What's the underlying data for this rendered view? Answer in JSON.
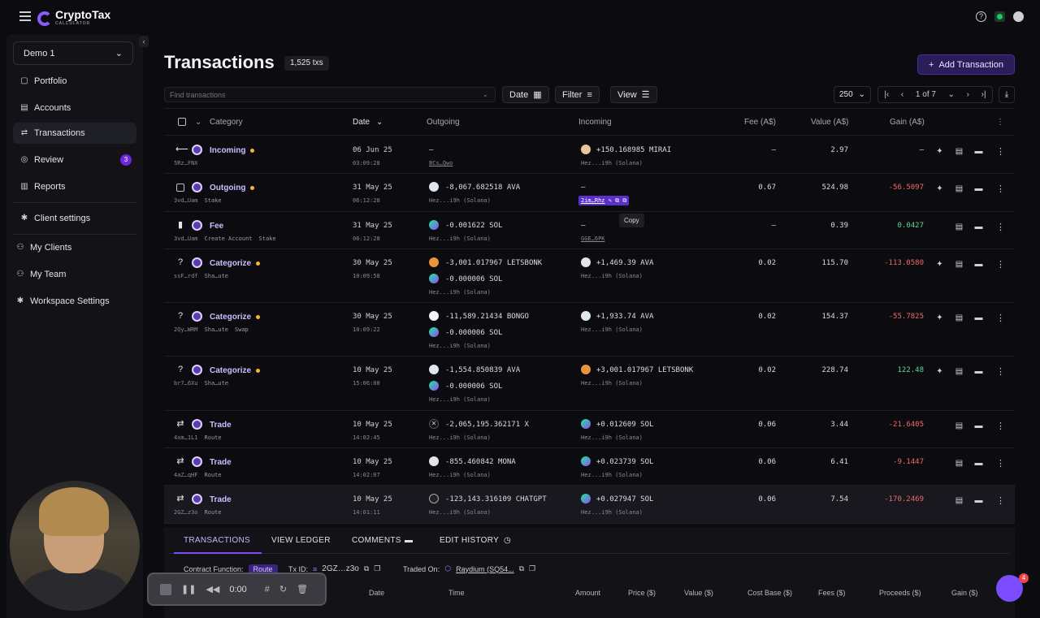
{
  "app": {
    "logo_main": "CryptoTax",
    "logo_sub": "CALCULATOR"
  },
  "sidebar": {
    "org": "Demo 1",
    "items": [
      {
        "label": "Portfolio"
      },
      {
        "label": "Accounts"
      },
      {
        "label": "Transactions"
      },
      {
        "label": "Review",
        "badge": "3"
      },
      {
        "label": "Reports"
      },
      {
        "label": "Client settings"
      },
      {
        "label": "My Clients"
      },
      {
        "label": "My Team"
      },
      {
        "label": "Workspace Settings"
      }
    ]
  },
  "header": {
    "title": "Transactions",
    "count": "1,525 txs",
    "add_button": "Add Transaction"
  },
  "toolbar": {
    "search_placeholder": "Find transactions",
    "date": "Date",
    "filter": "Filter",
    "view": "View",
    "page_size": "250",
    "page_info": "1 of 7"
  },
  "table": {
    "columns": {
      "category": "Category",
      "date": "Date",
      "outgoing": "Outgoing",
      "incoming": "Incoming",
      "fee": "Fee (A$)",
      "value": "Value (A$)",
      "gain": "Gain (A$)"
    },
    "rows": [
      {
        "category": "Incoming",
        "id": "5Rz…FNX",
        "tags": [],
        "date": "06 Jun 25",
        "time": "03:09:28",
        "out": [
          "—"
        ],
        "out_wallet": "BCs…Qwo",
        "in": [
          "+150.168985 MIRAI"
        ],
        "in_wallet": "Hez...i9h (Solana)",
        "fee": "—",
        "value": "2.97",
        "gain": "—"
      },
      {
        "category": "Outgoing",
        "id": "3vd…Uam",
        "tags": [
          "Stake"
        ],
        "date": "31 May 25",
        "time": "06:12:28",
        "out": [
          "-8,067.682518 AVA"
        ],
        "out_wallet": "Hez...i9h (Solana)",
        "in": [
          "—"
        ],
        "in_wallet": "2im…Rhz",
        "fee": "0.67",
        "value": "524.98",
        "gain": "-56.5097"
      },
      {
        "category": "Fee",
        "id": "3vd…Uam",
        "tags": [
          "Create Account",
          "Stake"
        ],
        "date": "31 May 25",
        "time": "06:12:28",
        "out": [
          "-0.001622 SOL"
        ],
        "out_wallet": "Hez...i9h (Solana)",
        "in": [
          "—"
        ],
        "in_wallet": "GGE…6PK",
        "fee": "—",
        "value": "0.39",
        "gain": "0.0427"
      },
      {
        "category": "Categorize",
        "id": "ssF…rdf",
        "tags": [
          "Sha…ute"
        ],
        "date": "30 May 25",
        "time": "10:09:58",
        "out": [
          "-3,001.017967 LETSBONK",
          "-0.000006 SOL"
        ],
        "out_wallet": "Hez...i9h (Solana)",
        "in": [
          "+1,469.39 AVA"
        ],
        "in_wallet": "Hez...i9h (Solana)",
        "fee": "0.02",
        "value": "115.70",
        "gain": "-113.0580"
      },
      {
        "category": "Categorize",
        "id": "2Qy…WRM",
        "tags": [
          "Sha…ute",
          "Swap"
        ],
        "date": "30 May 25",
        "time": "10:09:22",
        "out": [
          "-11,589.21434 BONGO",
          "-0.000006 SOL"
        ],
        "out_wallet": "Hez...i9h (Solana)",
        "in": [
          "+1,933.74 AVA"
        ],
        "in_wallet": "Hez...i9h (Solana)",
        "fee": "0.02",
        "value": "154.37",
        "gain": "-55.7825"
      },
      {
        "category": "Categorize",
        "id": "br7…6Xu",
        "tags": [
          "Sha…ute"
        ],
        "date": "10 May 25",
        "time": "15:06:00",
        "out": [
          "-1,554.850839 AVA",
          "-0.000006 SOL"
        ],
        "out_wallet": "Hez...i9h (Solana)",
        "in": [
          "+3,001.017967 LETSBONK"
        ],
        "in_wallet": "Hez...i9h (Solana)",
        "fee": "0.02",
        "value": "228.74",
        "gain": "122.48"
      },
      {
        "category": "Trade",
        "id": "4xm…1L1",
        "tags": [
          "Route"
        ],
        "date": "10 May 25",
        "time": "14:02:45",
        "out": [
          "-2,065,195.362171 X"
        ],
        "out_wallet": "Hez...i9h (Solana)",
        "in": [
          "+0.012609 SOL"
        ],
        "in_wallet": "Hez...i9h (Solana)",
        "fee": "0.06",
        "value": "3.44",
        "gain": "-21.6405"
      },
      {
        "category": "Trade",
        "id": "4aZ…qHF",
        "tags": [
          "Route"
        ],
        "date": "10 May 25",
        "time": "14:02:07",
        "out": [
          "-855.460842 MONA"
        ],
        "out_wallet": "Hez...i9h (Solana)",
        "in": [
          "+0.023739 SOL"
        ],
        "in_wallet": "Hez...i9h (Solana)",
        "fee": "0.06",
        "value": "6.41",
        "gain": "-9.1447"
      },
      {
        "category": "Trade",
        "id": "2GZ…z3o",
        "tags": [
          "Route"
        ],
        "date": "10 May 25",
        "time": "14:01:11",
        "out": [
          "-123,143.316109 CHATGPT"
        ],
        "out_wallet": "Hez...i9h (Solana)",
        "in": [
          "+0.027947 SOL"
        ],
        "in_wallet": "Hez...i9h (Solana)",
        "fee": "0.06",
        "value": "7.54",
        "gain": "-170.2469"
      }
    ]
  },
  "tooltip": "Copy",
  "detail": {
    "tabs": [
      "TRANSACTIONS",
      "VIEW LEDGER",
      "COMMENTS",
      "EDIT HISTORY"
    ],
    "contract_label": "Contract Function:",
    "contract_value": "Route",
    "txid_label": "Tx ID:",
    "txid_value": "2GZ…z3o",
    "traded_label": "Traded On:",
    "traded_value": "Raydium (SQ54...",
    "ledger_columns": [
      "Date",
      "Time",
      "Amount",
      "Price ($)",
      "Value ($)",
      "Cost Base ($)",
      "Fees ($)",
      "Proceeds ($)",
      "Gain ($)"
    ]
  },
  "recorder": {
    "time": "0:00"
  },
  "chat": {
    "badge": "4"
  },
  "colors": {
    "accent": "#7c4dff",
    "positive": "#5fd69a",
    "negative": "#ef6a6a",
    "warning": "#f5b731"
  }
}
